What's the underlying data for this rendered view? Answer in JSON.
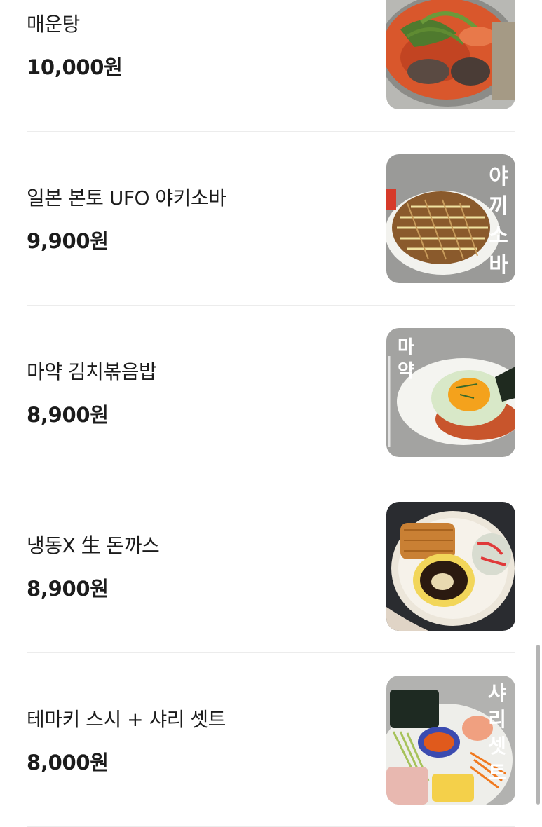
{
  "menu": {
    "items": [
      {
        "name": "매운탕",
        "price": "10,000원",
        "photo": "spicy-fish-stew-photo"
      },
      {
        "name": "일본 본토 UFO 야키소바",
        "price": "9,900원",
        "photo": "yakisoba-photo",
        "photo_text": [
          "야",
          "끼",
          "소",
          "바"
        ]
      },
      {
        "name": "마약 김치볶음밥",
        "price": "8,900원",
        "photo": "kimchi-fried-rice-photo",
        "photo_text": [
          "마",
          "약"
        ]
      },
      {
        "name": "냉동X 生 돈까스",
        "price": "8,900원",
        "photo": "pork-cutlet-photo"
      },
      {
        "name": "테마키 스시 + 샤리 셋트",
        "price": "8,000원",
        "photo": "temaki-sushi-set-photo",
        "photo_text": [
          "샤",
          "리",
          "셋",
          "트"
        ]
      }
    ]
  },
  "colors": {
    "divider": "#ececec",
    "text": "#1c1c1c",
    "scrollbar": "#b4b4b4"
  }
}
